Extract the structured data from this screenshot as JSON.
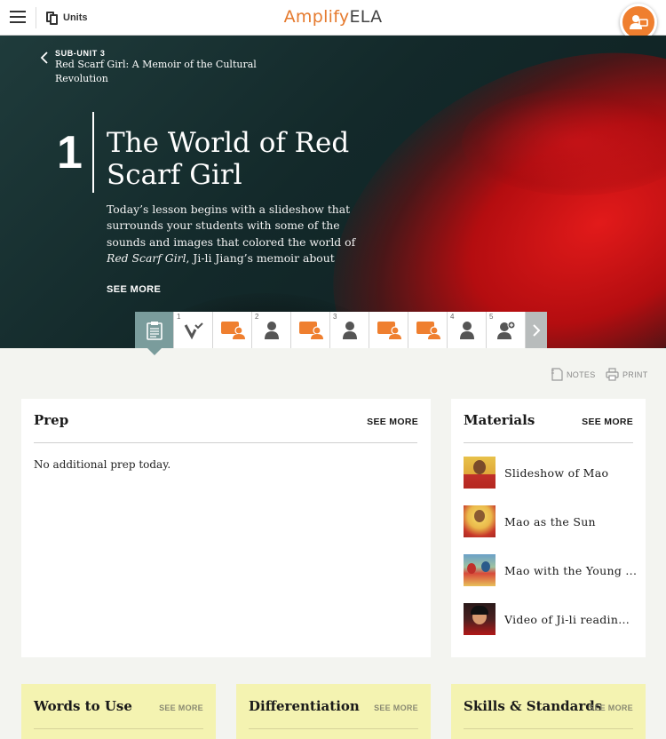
{
  "topbar": {
    "units_label": "Units",
    "logo_primary": "Amplify",
    "logo_secondary": "ELA"
  },
  "hero": {
    "subunit_label": "SUB-UNIT 3",
    "subunit_title": "Red Scarf Girl: A Memoir of the Cultural Revolution",
    "lesson_number": "1",
    "lesson_title": "The World of Red Scarf Girl",
    "lesson_description_start": "Today’s lesson begins with a slideshow that surrounds your students with some of the sounds and images that colored the world of ",
    "lesson_description_italic": "Red Scarf Girl",
    "lesson_description_end": ", Ji-li Jiang’s memoir about growing up during",
    "see_more": "SEE MORE"
  },
  "activity_strip": {
    "items": [
      {
        "number": "",
        "icon": "clipboard-icon",
        "active": true
      },
      {
        "number": "1",
        "icon": "vocab-check-icon",
        "active": false
      },
      {
        "number": "",
        "icon": "group-discussion-icon",
        "active": false
      },
      {
        "number": "2",
        "icon": "solo-person-icon",
        "active": false
      },
      {
        "number": "",
        "icon": "group-discussion-icon",
        "active": false
      },
      {
        "number": "3",
        "icon": "solo-person-icon",
        "active": false
      },
      {
        "number": "",
        "icon": "group-discussion-icon",
        "active": false
      },
      {
        "number": "",
        "icon": "group-discussion-icon",
        "active": false
      },
      {
        "number": "4",
        "icon": "solo-person-icon",
        "active": false
      },
      {
        "number": "5",
        "icon": "person-add-icon",
        "active": false
      }
    ],
    "next_icon": "chevron-right-icon"
  },
  "toolbar": {
    "notes_label": "NOTES",
    "print_label": "PRINT"
  },
  "prep": {
    "title": "Prep",
    "see_more": "SEE MORE",
    "body": "No additional prep today."
  },
  "materials": {
    "title": "Materials",
    "see_more": "SEE MORE",
    "items": [
      {
        "label": "Slideshow of Mao"
      },
      {
        "label": "Mao as the Sun"
      },
      {
        "label": "Mao with the Young ..."
      },
      {
        "label": "Video of Ji-li readin..."
      }
    ]
  },
  "bottom_cards": [
    {
      "title": "Words to Use",
      "see_more": "SEE MORE"
    },
    {
      "title": "Differentiation",
      "see_more": "SEE MORE"
    },
    {
      "title": "Skills & Standards",
      "see_more": "SEE MORE"
    }
  ],
  "colors": {
    "brand_orange": "#e57a2e",
    "active_strip": "#7a9c9c",
    "card_yellow": "#f4f3b1",
    "page_bg": "#f3f4f0"
  }
}
